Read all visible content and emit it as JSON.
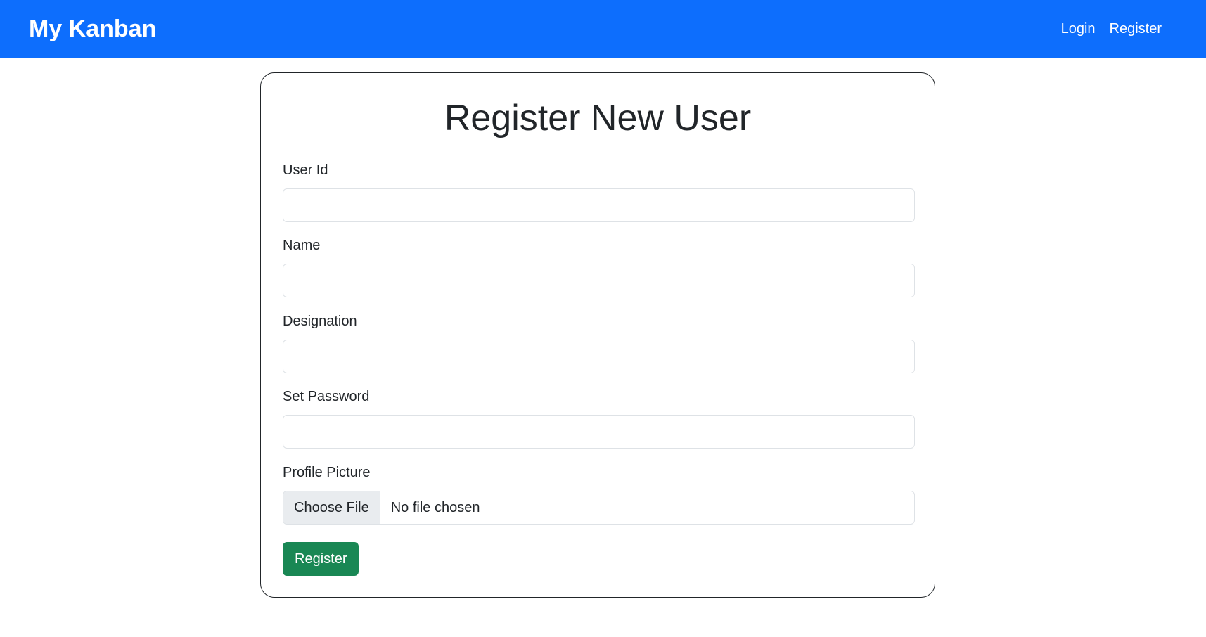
{
  "navbar": {
    "brand": "My Kanban",
    "links": [
      "Login",
      "Register"
    ]
  },
  "form": {
    "title": "Register New User",
    "fields": [
      {
        "label": "User Id",
        "value": "",
        "placeholder": ""
      },
      {
        "label": "Name",
        "value": "",
        "placeholder": ""
      },
      {
        "label": "Designation",
        "value": "",
        "placeholder": ""
      },
      {
        "label": "Set Password",
        "value": "",
        "placeholder": ""
      }
    ],
    "profile_picture": {
      "label": "Profile Picture",
      "button_label": "Choose File",
      "status": "No file chosen"
    },
    "submit_label": "Register"
  },
  "colors": {
    "navbar": "#0d6efd",
    "submit": "#198754"
  }
}
